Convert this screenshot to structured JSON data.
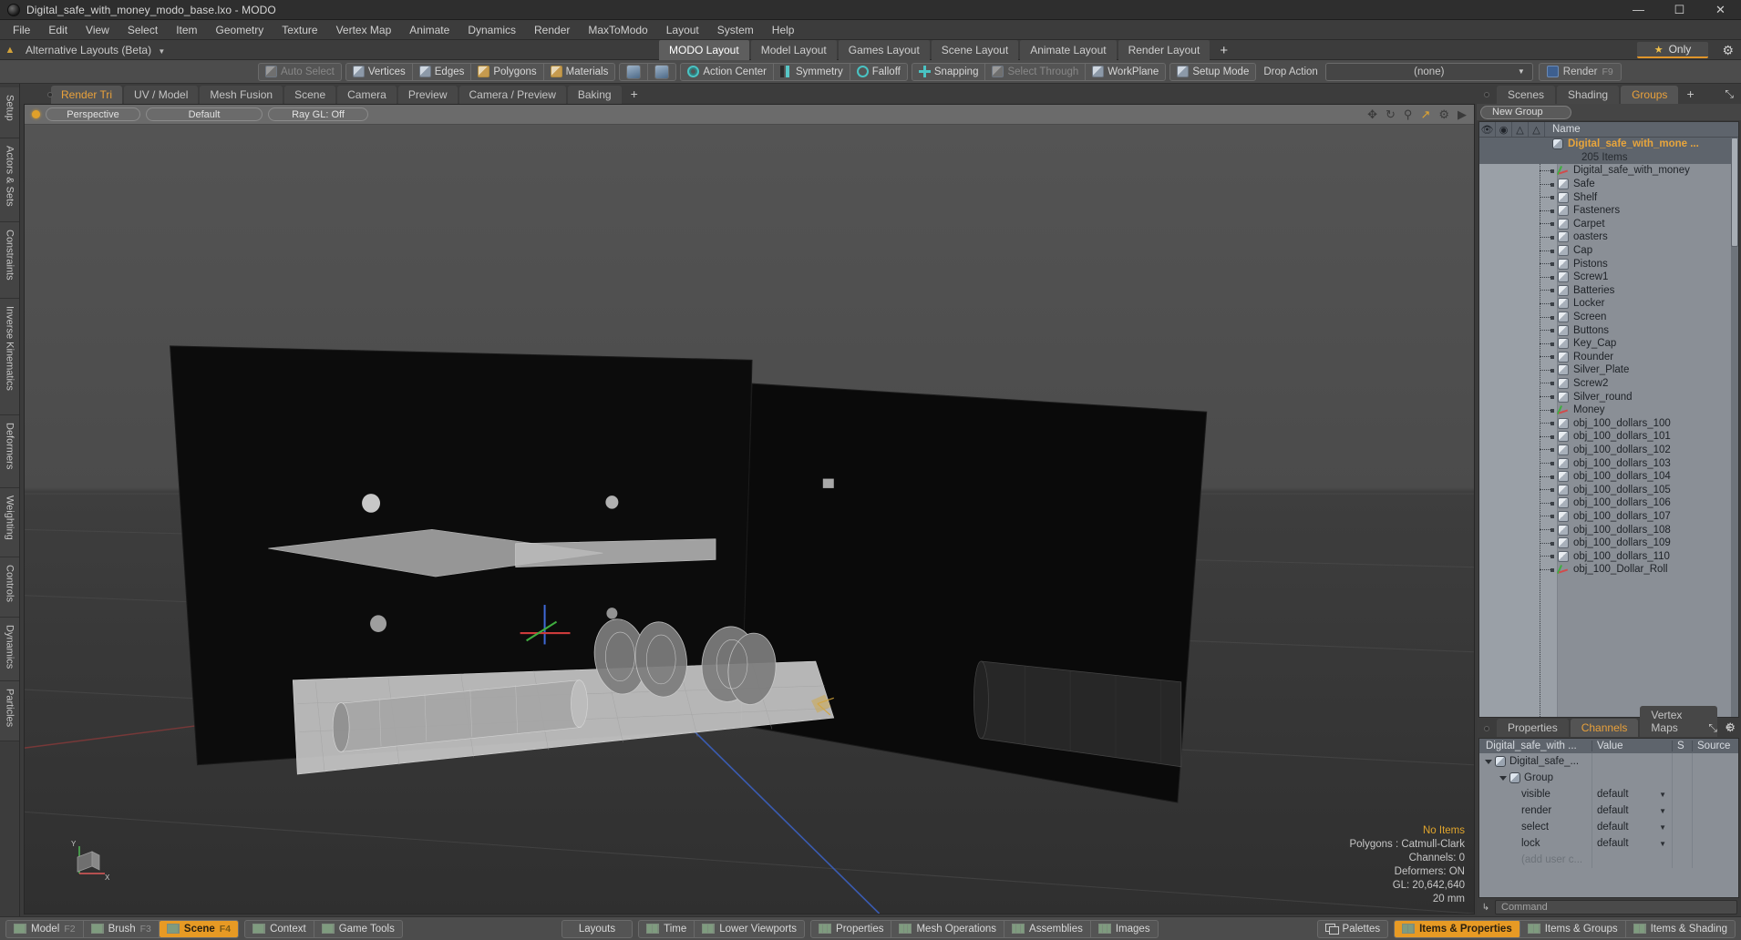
{
  "window": {
    "title": "Digital_safe_with_money_modo_base.lxo - MODO",
    "app_icon": "modo-logo-icon",
    "minimize": "—",
    "maximize": "☐",
    "close": "✕"
  },
  "menubar": {
    "items": [
      "File",
      "Edit",
      "View",
      "Select",
      "Item",
      "Geometry",
      "Texture",
      "Vertex Map",
      "Animate",
      "Dynamics",
      "Render",
      "MaxToModo",
      "Layout",
      "System",
      "Help"
    ]
  },
  "layout_bar": {
    "up_arrow": "⬆",
    "alt_layouts": "Alternative Layouts (Beta)",
    "caret": "▼",
    "tabs": [
      {
        "label": "MODO Layout",
        "active": true
      },
      {
        "label": "Model Layout",
        "active": false
      },
      {
        "label": "Games Layout",
        "active": false
      },
      {
        "label": "Scene Layout",
        "active": false
      },
      {
        "label": "Animate Layout",
        "active": false
      },
      {
        "label": "Render Layout",
        "active": false
      }
    ],
    "add_tab": "+",
    "only_star": "★",
    "only_label": "Only",
    "gear": "⚙"
  },
  "toolbar": {
    "auto_select": "Auto Select",
    "vertices": "Vertices",
    "edges": "Edges",
    "polygons": "Polygons",
    "materials": "Materials",
    "action_center": "Action Center",
    "symmetry": "Symmetry",
    "falloff": "Falloff",
    "snapping": "Snapping",
    "select_through": "Select Through",
    "workplane": "WorkPlane",
    "setup_mode": "Setup Mode",
    "drop_action_label": "Drop Action",
    "drop_action_value": "(none)",
    "drop_caret": "▼",
    "render": "Render",
    "render_key": "F9"
  },
  "left_strip": {
    "tabs": [
      "Setup",
      "Actors & Sets",
      "Constraints",
      "Inverse Kinematics",
      "Deformers",
      "Weighting",
      "Controls",
      "Dynamics",
      "Particles"
    ]
  },
  "viewport": {
    "tabs": [
      {
        "label": "Render Tri",
        "active": true
      },
      {
        "label": "UV / Model",
        "active": false
      },
      {
        "label": "Mesh Fusion",
        "active": false
      },
      {
        "label": "Scene",
        "active": false
      },
      {
        "label": "Camera",
        "active": false
      },
      {
        "label": "Preview",
        "active": false
      },
      {
        "label": "Camera / Preview",
        "active": false
      },
      {
        "label": "Baking",
        "active": false
      }
    ],
    "add_tab": "+",
    "header_pills": [
      "Perspective",
      "Default",
      "Ray GL: Off"
    ],
    "nav_icons": [
      "move-icon",
      "rotate-icon",
      "zoom-icon",
      "fit-icon",
      "gear-icon",
      "play-icon"
    ],
    "stats": {
      "no_items": "No Items",
      "polygons": "Polygons : Catmull-Clark",
      "channels": "Channels: 0",
      "deformers": "Deformers: ON",
      "gl": "GL: 20,642,640",
      "units": "20 mm"
    },
    "axis_labels": {
      "y": "Y",
      "x": "X"
    }
  },
  "right_panel": {
    "tabs": [
      {
        "label": "Scenes",
        "active": false
      },
      {
        "label": "Shading",
        "active": false
      },
      {
        "label": "Groups",
        "active": true
      }
    ],
    "add_tab": "+",
    "expand_icon": "⤡",
    "new_group_button": "New Group",
    "columns": [
      "eye-icon",
      "render-icon",
      "select-icon",
      "lock-icon"
    ],
    "name_header": "Name",
    "selected_group": {
      "name": "Digital_safe_with_mone ...",
      "item_count": "205 Items"
    },
    "items": [
      {
        "label": "Digital_safe_with_money",
        "icon": "axis-icon"
      },
      {
        "label": "Safe",
        "icon": "mesh-icon"
      },
      {
        "label": "Shelf",
        "icon": "mesh-icon"
      },
      {
        "label": "Fasteners",
        "icon": "mesh-icon"
      },
      {
        "label": "Carpet",
        "icon": "mesh-icon"
      },
      {
        "label": "oasters",
        "icon": "mesh-icon"
      },
      {
        "label": "Cap",
        "icon": "mesh-icon"
      },
      {
        "label": "Pistons",
        "icon": "mesh-icon"
      },
      {
        "label": "Screw1",
        "icon": "mesh-icon"
      },
      {
        "label": "Batteries",
        "icon": "mesh-icon"
      },
      {
        "label": "Locker",
        "icon": "mesh-icon"
      },
      {
        "label": "Screen",
        "icon": "mesh-icon"
      },
      {
        "label": "Buttons",
        "icon": "mesh-icon"
      },
      {
        "label": "Key_Cap",
        "icon": "mesh-icon"
      },
      {
        "label": "Rounder",
        "icon": "mesh-icon"
      },
      {
        "label": "Silver_Plate",
        "icon": "mesh-icon"
      },
      {
        "label": "Screw2",
        "icon": "mesh-icon"
      },
      {
        "label": "Silver_round",
        "icon": "mesh-icon"
      },
      {
        "label": "Money",
        "icon": "axis-icon"
      },
      {
        "label": "obj_100_dollars_100",
        "icon": "mesh-icon"
      },
      {
        "label": "obj_100_dollars_101",
        "icon": "mesh-icon"
      },
      {
        "label": "obj_100_dollars_102",
        "icon": "mesh-icon"
      },
      {
        "label": "obj_100_dollars_103",
        "icon": "mesh-icon"
      },
      {
        "label": "obj_100_dollars_104",
        "icon": "mesh-icon"
      },
      {
        "label": "obj_100_dollars_105",
        "icon": "mesh-icon"
      },
      {
        "label": "obj_100_dollars_106",
        "icon": "mesh-icon"
      },
      {
        "label": "obj_100_dollars_107",
        "icon": "mesh-icon"
      },
      {
        "label": "obj_100_dollars_108",
        "icon": "mesh-icon"
      },
      {
        "label": "obj_100_dollars_109",
        "icon": "mesh-icon"
      },
      {
        "label": "obj_100_dollars_110",
        "icon": "mesh-icon"
      },
      {
        "label": "obj_100_Dollar_Roll",
        "icon": "axis-icon"
      }
    ]
  },
  "properties_panel": {
    "tabs": [
      {
        "label": "Properties",
        "active": false
      },
      {
        "label": "Channels",
        "active": true
      },
      {
        "label": "Vertex Maps",
        "active": false
      }
    ],
    "add_tab": "+",
    "expand_icon": "⤡",
    "gear_icon": "⚙",
    "columns": [
      "Digital_safe_with ...",
      "Value",
      "S",
      "Source"
    ],
    "tree": [
      {
        "label": "Digital_safe_...",
        "value": "",
        "depth": 0,
        "icon": "group-icon",
        "expander": "down"
      },
      {
        "label": "Group",
        "value": "",
        "depth": 1,
        "icon": "group-icon",
        "expander": "down"
      },
      {
        "label": "visible",
        "value": "default",
        "depth": 2,
        "icon": "",
        "expander": ""
      },
      {
        "label": "render",
        "value": "default",
        "depth": 2,
        "icon": "",
        "expander": ""
      },
      {
        "label": "select",
        "value": "default",
        "depth": 2,
        "icon": "",
        "expander": ""
      },
      {
        "label": "lock",
        "value": "default",
        "depth": 2,
        "icon": "",
        "expander": ""
      },
      {
        "label": "(add user c...",
        "value": "",
        "depth": 2,
        "icon": "",
        "expander": "",
        "dim": true
      }
    ],
    "command_arrow": "↳",
    "command_placeholder": "Command"
  },
  "statusbar": {
    "left_groups": [
      [
        {
          "label": "Model",
          "key": "F2",
          "active": false,
          "icon": "viewport-one-icon"
        },
        {
          "label": "Brush",
          "key": "F3",
          "active": false,
          "icon": "viewport-one-icon"
        },
        {
          "label": "Scene",
          "key": "F4",
          "active": true,
          "icon": "viewport-one-icon"
        }
      ],
      [
        {
          "label": "Context",
          "key": "",
          "active": false,
          "icon": "viewport-one-icon"
        },
        {
          "label": "Game Tools",
          "key": "",
          "active": false,
          "icon": "viewport-one-icon"
        }
      ]
    ],
    "center_groups": [
      [
        {
          "label": "Layouts",
          "icon": "none"
        }
      ],
      [
        {
          "label": "Time",
          "icon": "viewport-two-icon"
        },
        {
          "label": "Lower Viewports",
          "icon": "viewport-two-icon"
        }
      ],
      [
        {
          "label": "Properties",
          "icon": "viewport-three-icon"
        },
        {
          "label": "Mesh Operations",
          "icon": "viewport-three-icon"
        },
        {
          "label": "Assemblies",
          "icon": "viewport-three-icon"
        },
        {
          "label": "Images",
          "icon": "viewport-three-icon"
        }
      ]
    ],
    "right_groups": [
      [
        {
          "label": "Palettes",
          "icon": "palettes-icon",
          "active": false
        }
      ],
      [
        {
          "label": "Items & Properties",
          "icon": "viewport-two-icon",
          "active": true
        },
        {
          "label": "Items & Groups",
          "icon": "viewport-two-icon",
          "active": false
        },
        {
          "label": "Items & Shading",
          "icon": "viewport-two-icon",
          "active": false
        }
      ]
    ]
  },
  "colors": {
    "accent_orange": "#e79a24",
    "panel_bg": "#3c3c3c",
    "toolbar_bg": "#4c4c4c",
    "list_bg": "#8a8f96",
    "viewport_bg": "#3d3d3d"
  }
}
